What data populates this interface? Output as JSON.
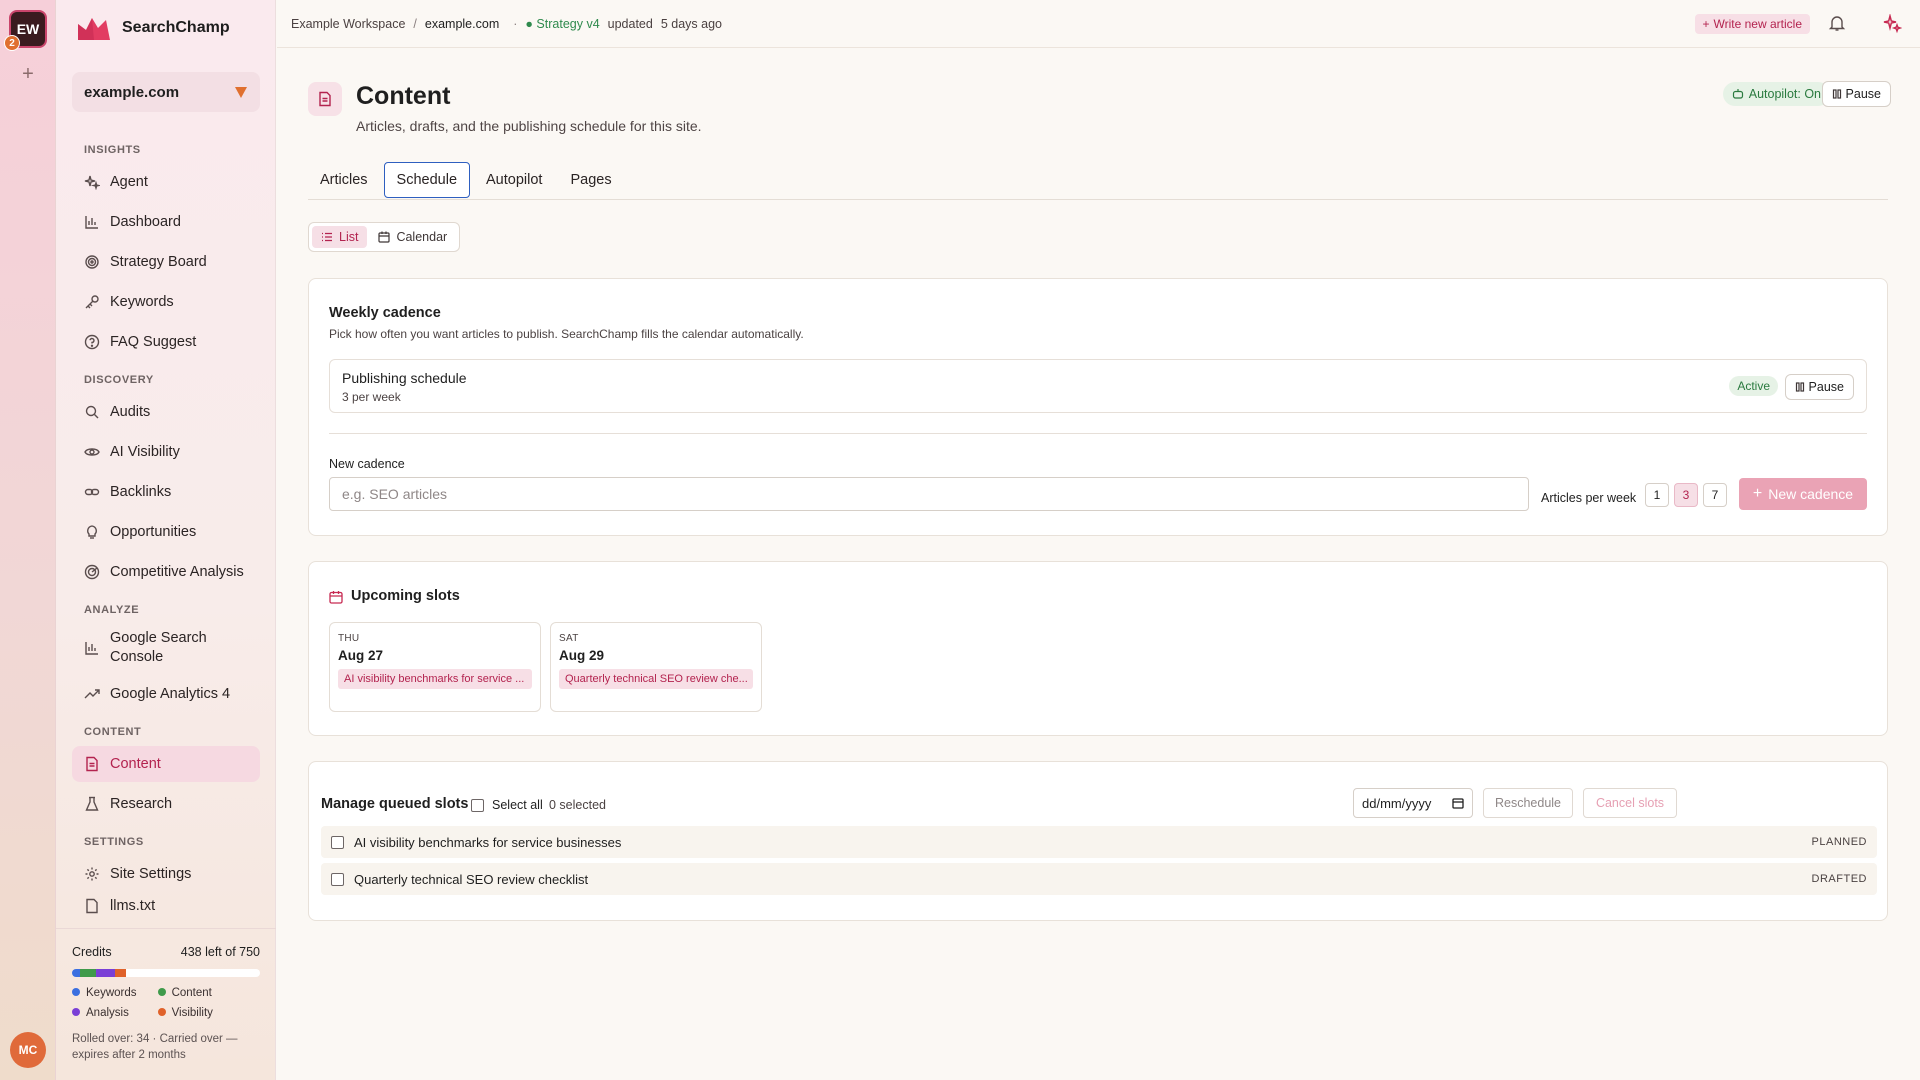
{
  "rail": {
    "workspace_initials": "EW",
    "workspace_badge": "2",
    "user_initials": "MC"
  },
  "brand": {
    "name": "SearchChamp"
  },
  "site_selector": {
    "value": "example.com"
  },
  "nav": {
    "sections": [
      {
        "title": "INSIGHTS",
        "items": [
          "Agent",
          "Dashboard",
          "Strategy Board",
          "Keywords",
          "FAQ Suggest"
        ]
      },
      {
        "title": "DISCOVERY",
        "items": [
          "Audits",
          "AI Visibility",
          "Backlinks",
          "Opportunities",
          "Competitive Analysis"
        ]
      },
      {
        "title": "ANALYZE",
        "items": [
          "Google Search Console",
          "Google Analytics 4"
        ]
      },
      {
        "title": "CONTENT",
        "items": [
          "Content",
          "Research"
        ]
      },
      {
        "title": "SETTINGS",
        "items": [
          "Site Settings",
          "llms.txt"
        ]
      }
    ],
    "active": "Content"
  },
  "credits": {
    "label": "Credits",
    "remaining": "438 left of 750",
    "segments": [
      {
        "name": "Keywords",
        "color": "#3b6fe0",
        "fraction": 0.04
      },
      {
        "name": "Content",
        "color": "#3f9a4a",
        "fraction": 0.09
      },
      {
        "name": "Analysis",
        "color": "#7a3fd6",
        "fraction": 0.1
      },
      {
        "name": "Visibility",
        "color": "#e0622a",
        "fraction": 0.06
      }
    ],
    "note": "Rolled over: 34 · Carried over — expires after 2 months"
  },
  "topbar": {
    "workspace": "Example Workspace",
    "separator": "/",
    "site": "example.com",
    "strategy": "● Strategy v4",
    "updated_label": "updated",
    "updated_time": "5 days ago",
    "write_button": "Write new article"
  },
  "page": {
    "title": "Content",
    "subtitle": "Articles, drafts, and the publishing schedule for this site.",
    "autopilot": "Autopilot: On",
    "pause": "Pause",
    "tabs": [
      "Articles",
      "Schedule",
      "Autopilot",
      "Pages"
    ],
    "selected_tab": "Schedule",
    "view_toggle": {
      "list": "List",
      "calendar": "Calendar",
      "selected": "List"
    }
  },
  "cadence": {
    "title": "Weekly cadence",
    "description": "Pick how often you want articles to publish. SearchChamp fills the calendar automatically.",
    "schedule_name": "Publishing schedule",
    "schedule_freq": "3 per week",
    "status": "Active",
    "pause": "Pause",
    "new_label": "New cadence",
    "new_placeholder": "e.g. SEO articles",
    "per_week_label": "Articles per week",
    "per_week_options": [
      "1",
      "3",
      "7"
    ],
    "per_week_selected": "3",
    "new_button": "New cadence"
  },
  "upcoming": {
    "title": "Upcoming slots",
    "slots": [
      {
        "weekday": "THU",
        "date": "Aug 27",
        "article": "AI visibility benchmarks for service ..."
      },
      {
        "weekday": "SAT",
        "date": "Aug 29",
        "article": "Quarterly technical SEO review che..."
      }
    ]
  },
  "queue": {
    "title": "Manage queued slots",
    "select_all": "Select all",
    "selected_count": "0 selected",
    "date_placeholder": "dd/mm/yyyy",
    "reschedule": "Reschedule",
    "cancel": "Cancel slots",
    "rows": [
      {
        "title": "AI visibility benchmarks for service businesses",
        "status": "PLANNED"
      },
      {
        "title": "Quarterly technical SEO review checklist",
        "status": "DRAFTED"
      }
    ]
  }
}
